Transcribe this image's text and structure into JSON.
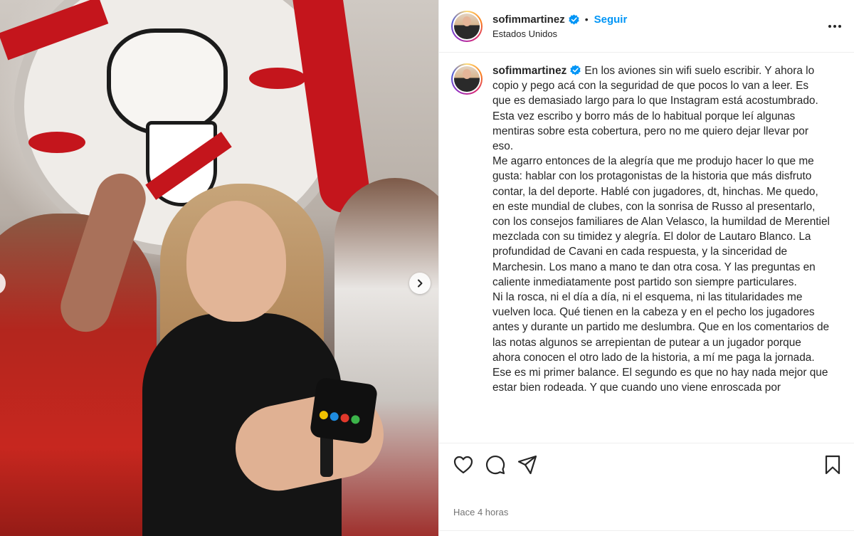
{
  "post": {
    "username": "sofimmartinez",
    "verified": true,
    "separator": "•",
    "follow_label": "Seguir",
    "location": "Estados Unidos",
    "timestamp": "Hace 4 horas"
  },
  "caption": {
    "text": "En los aviones sin wifi suelo escribir. Y ahora lo copio y pego acá con la seguridad de que pocos lo van a leer. Es que es demasiado largo para lo que Instagram está acostumbrado.\nEsta vez escribo y borro más de lo habitual porque leí algunas mentiras sobre esta cobertura, pero no me quiero dejar llevar por eso.\nMe agarro entonces de la alegría que me produjo hacer lo que me gusta: hablar con los protagonistas de la historia que más disfruto contar, la del deporte. Hablé con jugadores, dt, hinchas. Me quedo, en este mundial de clubes, con la sonrisa de Russo al presentarlo, con los consejos familiares de Alan Velasco, la humildad de Merentiel mezclada con su timidez y alegría. El dolor de Lautaro Blanco. La profundidad de Cavani en cada respuesta, y la sinceridad de Marchesin. Los mano a mano te dan otra cosa. Y las preguntas en caliente inmediatamente post partido son siempre particulares.\nNi la rosca, ni el día a día, ni el esquema, ni las titularidades me vuelven loca. Qué tienen en la cabeza y en el pecho los jugadores antes y durante un partido me deslumbra. Que en los comentarios de las notas algunos se arrepientan de putear a un jugador porque ahora conocen el otro lado de la historia, a mí me paga la jornada.\nEse es mi primer balance. El segundo es que no hay nada mejor que estar bien rodeada. Y que cuando uno viene enroscada por"
  },
  "icons": {
    "verified": "verified-badge-icon",
    "more": "more-options-icon",
    "like": "heart-icon",
    "comment": "comment-bubble-icon",
    "share": "send-icon",
    "save": "bookmark-icon",
    "carousel_next": "chevron-right-icon"
  },
  "colors": {
    "link": "#0095f6",
    "verified": "#0095f6",
    "text": "#262626",
    "muted": "#737373",
    "divider": "#efefef"
  }
}
